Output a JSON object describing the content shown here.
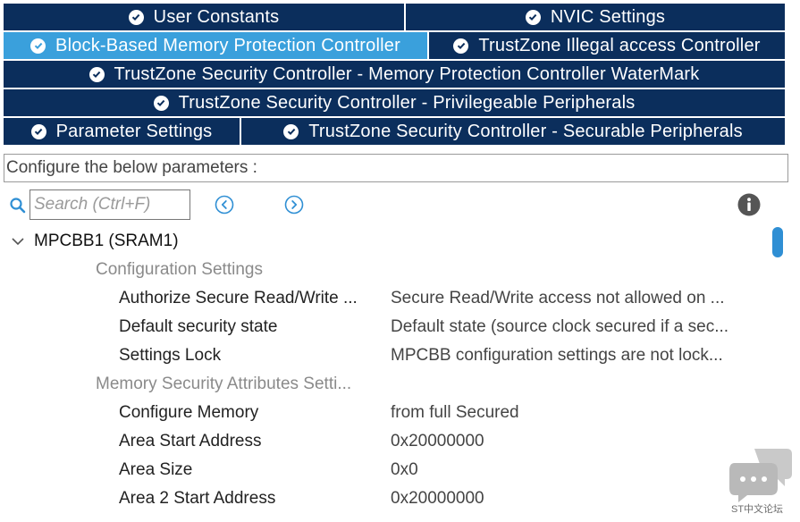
{
  "tabs": {
    "rows": [
      [
        {
          "label": "User Constants",
          "active": false
        },
        {
          "label": "NVIC Settings",
          "active": false
        }
      ],
      [
        {
          "label": "Block-Based Memory Protection Controller",
          "active": true
        },
        {
          "label": "TrustZone Illegal access Controller",
          "active": false
        }
      ],
      [
        {
          "label": "TrustZone Security Controller - Memory Protection Controller WaterMark",
          "active": false
        }
      ],
      [
        {
          "label": "TrustZone Security Controller - Privilegeable Peripherals",
          "active": false
        }
      ],
      [
        {
          "label": "Parameter Settings",
          "active": false
        },
        {
          "label": "TrustZone Security Controller - Securable Peripherals",
          "active": false
        }
      ]
    ]
  },
  "config": {
    "label": "Configure the below parameters :"
  },
  "search": {
    "placeholder": "Search (Ctrl+F)",
    "value": ""
  },
  "tree": {
    "group": "MPCBB1 (SRAM1)",
    "sections": [
      {
        "title": "Configuration Settings",
        "params": [
          {
            "name": "Authorize Secure Read/Write ...",
            "value": "Secure Read/Write access not allowed on ..."
          },
          {
            "name": "Default security state",
            "value": "Default state (source clock secured if a sec..."
          },
          {
            "name": "Settings Lock",
            "value": "MPCBB configuration settings are not lock..."
          }
        ]
      },
      {
        "title": "Memory Security Attributes Setti...",
        "params": [
          {
            "name": "Configure Memory",
            "value": "from full Secured"
          },
          {
            "name": "Area Start Address",
            "value": "0x20000000"
          },
          {
            "name": "Area Size",
            "value": "0x0"
          },
          {
            "name": "Area 2 Start Address",
            "value": "0x20000000"
          }
        ]
      }
    ]
  },
  "watermark": {
    "text": "ST中文论坛"
  },
  "colors": {
    "tab_bg": "#0b2e5c",
    "tab_active": "#3aa0dc",
    "accent": "#2f8fd4"
  },
  "icons": {
    "search": "search-icon",
    "prev": "chevron-left-circle-icon",
    "next": "chevron-right-circle-icon",
    "info": "info-icon",
    "expand": "chevron-down-icon",
    "check": "check-circle-icon"
  }
}
